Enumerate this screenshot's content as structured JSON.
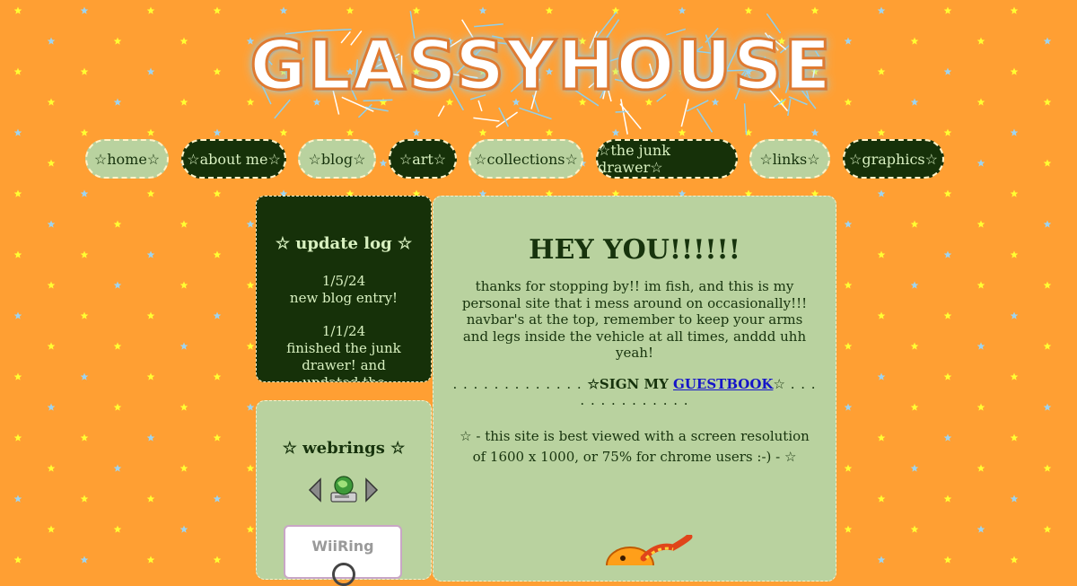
{
  "site": {
    "logo_text": "GLASSYHOUSE",
    "colors": {
      "background": "#ff9f33",
      "panel_light": "#b9d29f",
      "panel_dark": "#163109",
      "text_dark": "#17330d",
      "text_light": "#d8f0c0",
      "link": "#1515c8",
      "star_yellow": "#ffff33",
      "star_blue": "#9ed4f0"
    }
  },
  "navbar": {
    "items": [
      {
        "label": "☆home☆",
        "style": "light"
      },
      {
        "label": "☆about me☆",
        "style": "dark"
      },
      {
        "label": "☆blog☆",
        "style": "light"
      },
      {
        "label": "☆art☆",
        "style": "dark"
      },
      {
        "label": "☆collections☆",
        "style": "light"
      },
      {
        "label": "☆the junk drawer☆",
        "style": "dark"
      },
      {
        "label": "☆links☆",
        "style": "light"
      },
      {
        "label": "☆graphics☆",
        "style": "dark"
      }
    ]
  },
  "update_log": {
    "title": "☆ update log ☆",
    "entries": [
      {
        "date": "1/5/24",
        "text": "new blog entry!"
      },
      {
        "date": "1/1/24",
        "text": "finished the junk drawer! and updated the credits page to"
      }
    ]
  },
  "webrings": {
    "title": "☆ webrings ☆",
    "prev_icon": "left-arrow-icon",
    "home_icon": "computer-globe-icon",
    "next_icon": "right-arrow-icon",
    "badge_label": "WiiRing"
  },
  "main": {
    "heading": "HEY YOU!!!!!!",
    "intro": "thanks for stopping by!! im fish, and this is my personal site that i mess around on occasionally!!! navbar's at the top, remember to keep your arms and legs inside the vehicle at all times, anddd uhh yeah!",
    "guestbook": {
      "dots_left": ". . . . . . . . . . . . . ",
      "prefix": "☆SIGN MY ",
      "link": "GUESTBOOK",
      "suffix": "☆",
      "dots_right": " . . . . . . . . . . . . . ."
    },
    "resolution_note": "☆ - this site is best viewed with a screen resolution of 1600 x 1000, or 75% for chrome users :-) - ☆"
  }
}
